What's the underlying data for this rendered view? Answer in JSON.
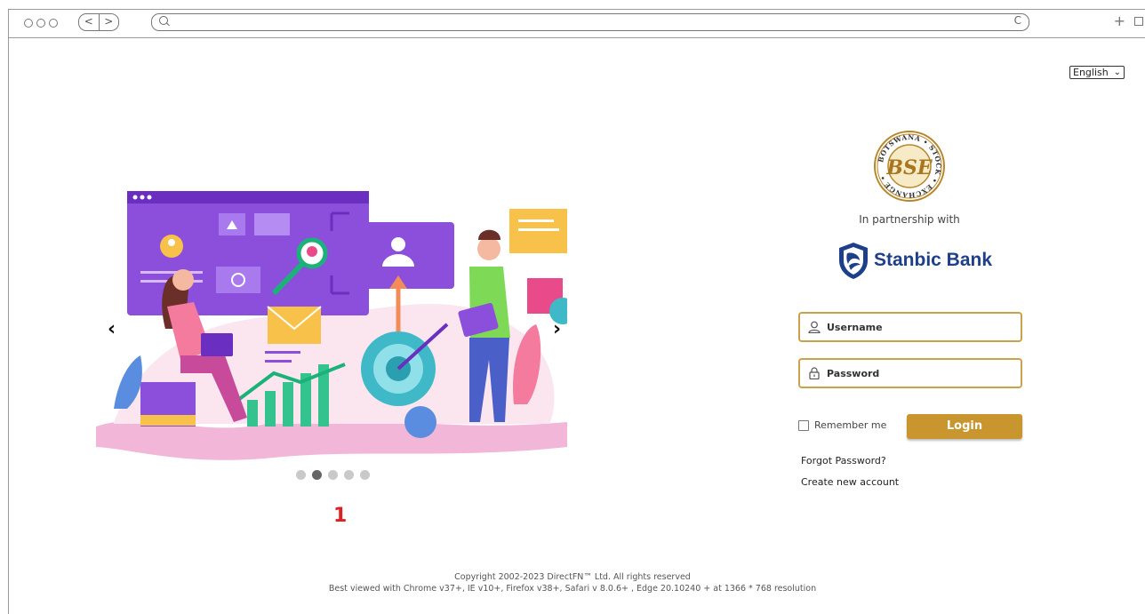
{
  "browser": {
    "nav_back": "<",
    "nav_forward": ">",
    "reload": "C",
    "new_tab": "+"
  },
  "language": {
    "selected": "English",
    "caret": "⌄"
  },
  "carousel": {
    "prev": "‹",
    "next": "›",
    "dots": 5,
    "active_dot": 2,
    "slide_number": "1"
  },
  "logo": {
    "name": "Botswana Stock Exchange",
    "ring_text": "BOTSWANA STOCK EXCHANGE",
    "initials": "BSE"
  },
  "partnership": {
    "text": "In partnership with"
  },
  "bank": {
    "name": "Stanbic Bank"
  },
  "form": {
    "username_placeholder": "Username",
    "password_placeholder": "Password",
    "remember_label": "Remember me",
    "login_label": "Login",
    "forgot_label": "Forgot Password?",
    "create_label": "Create new account"
  },
  "footer": {
    "copyright": "Copyright 2002-2023 DirectFN™ Ltd. All rights reserved",
    "compat": "Best viewed with Chrome v37+, IE v10+, Firefox v38+, Safari v 8.0.6+ , Edge 20.10240 + at 1366 * 768 resolution"
  },
  "colors": {
    "accent": "#c8952e",
    "field_border": "#c9a24a",
    "bank_blue": "#1e3f8a",
    "slide_number": "#e02020"
  }
}
